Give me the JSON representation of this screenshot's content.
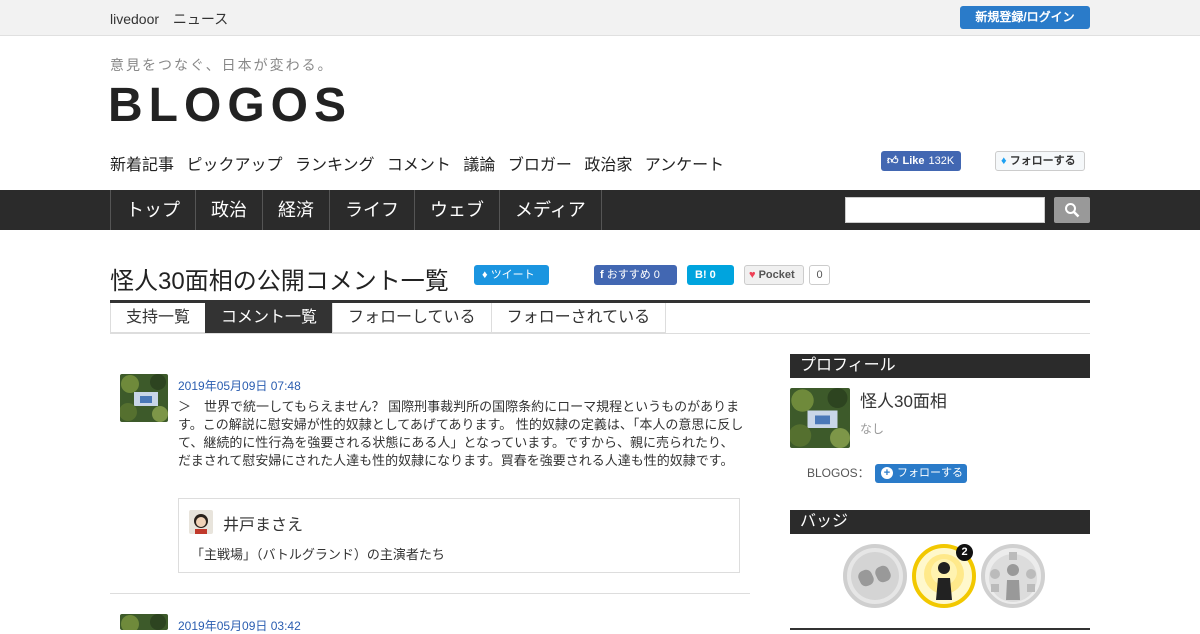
{
  "topbar": {
    "brand_a": "livedoor",
    "brand_b": "ニュース",
    "login": "新規登録/ログイン"
  },
  "site": {
    "tagline": "意見をつなぐ、日本が変わる。",
    "logo": "BLOGOS"
  },
  "subnav": [
    "新着記事",
    "ピックアップ",
    "ランキング",
    "コメント",
    "議論",
    "ブロガー",
    "政治家",
    "アンケート"
  ],
  "social_header": {
    "fb_like": "Like",
    "fb_count": "132K",
    "tw_follow": "フォローする"
  },
  "mainnav": [
    "トップ",
    "政治",
    "経済",
    "ライフ",
    "ウェブ",
    "メディア"
  ],
  "search": {
    "value": ""
  },
  "page": {
    "title": "怪人30面相の公開コメント一覧",
    "tweet": "ツイート",
    "fb_share": "おすすめ 0",
    "hatena": "B! 0",
    "pocket": "Pocket",
    "pocket_count": "0"
  },
  "tabs": [
    "支持一覧",
    "コメント一覧",
    "フォローしている",
    "フォローされている"
  ],
  "active_tab": 1,
  "comments": [
    {
      "date": "2019年05月09日 07:48",
      "text": "＞　世界で統一してもらえません？ 国際刑事裁判所の国際条約にローマ規程というものがあります。この解説に慰安婦が性的奴隷としてあげてあります。 性的奴隷の定義は、「本人の意思に反して、継続的に性行為を強要される状態にある人」となっています。ですから、親に売られたり、だまされて慰安婦にされた人達も性的奴隷になります。買春を強要される人達も性的奴隷です。",
      "quote": {
        "author": "井戸まさえ",
        "title": "「主戦場」（バトルグランド）の主演者たち"
      }
    },
    {
      "date": "2019年05月09日 03:42"
    }
  ],
  "sidebar": {
    "profile_header": "プロフィール",
    "name": "怪人30面相",
    "desc": "なし",
    "blogos_label": "BLOGOS：",
    "follow": "フォローする",
    "badge_header": "バッジ",
    "badge_count": "2"
  },
  "colors": {
    "accent": "#2a7bc9",
    "nav_bg": "#2b2b2b",
    "link": "#2a5db0",
    "badge_gold": "#f2c800"
  },
  "icons": [
    "search-icon",
    "twitter-bird-icon",
    "facebook-icon",
    "pocket-icon",
    "binoculars-badge-icon",
    "speaker-badge-icon",
    "social-badge-icon"
  ]
}
